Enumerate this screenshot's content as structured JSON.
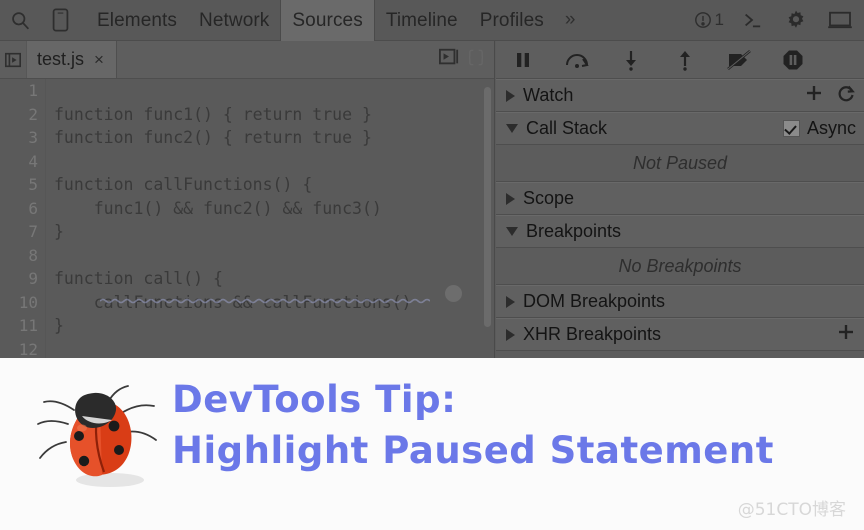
{
  "toolbar": {
    "icons": [
      {
        "name": "inspect-element-icon",
        "glyph": "search"
      },
      {
        "name": "device-toolbar-icon",
        "glyph": "device"
      }
    ],
    "tabs": [
      {
        "label": "Elements",
        "active": false
      },
      {
        "label": "Network",
        "active": false
      },
      {
        "label": "Sources",
        "active": true
      },
      {
        "label": "Timeline",
        "active": false
      },
      {
        "label": "Profiles",
        "active": false
      }
    ],
    "more_label": "»",
    "error_count": "1",
    "right_icons": [
      {
        "name": "warning-count-icon",
        "label": "1"
      },
      {
        "name": "console-drawer-icon",
        "label": ">_"
      },
      {
        "name": "settings-gear-icon",
        "label": "gear"
      },
      {
        "name": "dock-side-icon",
        "label": "dock"
      }
    ]
  },
  "editor": {
    "navigator_button": "show-navigator",
    "file_tab": {
      "name": "test.js",
      "close": "×"
    },
    "right_buttons": [
      "pretty-print",
      "format"
    ],
    "lines": [
      {
        "num": "1",
        "text": ""
      },
      {
        "num": "2",
        "text": "function func1() { return true }"
      },
      {
        "num": "3",
        "text": "function func2() { return true }"
      },
      {
        "num": "4",
        "text": ""
      },
      {
        "num": "5",
        "text": "function callFunctions() {"
      },
      {
        "num": "6",
        "text": "    func1() && func2() && func3()"
      },
      {
        "num": "7",
        "text": "}"
      },
      {
        "num": "8",
        "text": ""
      },
      {
        "num": "9",
        "text": "function call() {"
      },
      {
        "num": "10",
        "text": "    callFunctions && callFunctions()"
      },
      {
        "num": "11",
        "text": "}"
      },
      {
        "num": "12",
        "text": ""
      }
    ]
  },
  "debugger": {
    "controls": [
      {
        "name": "resume-pause-button",
        "title": "Pause script execution"
      },
      {
        "name": "step-over-button",
        "title": "Step over next function call"
      },
      {
        "name": "step-into-button",
        "title": "Step into next function call"
      },
      {
        "name": "step-out-button",
        "title": "Step out of current function"
      },
      {
        "name": "deactivate-breakpoints-button",
        "title": "Deactivate breakpoints"
      },
      {
        "name": "pause-on-exceptions-button",
        "title": "Pause on exceptions"
      }
    ],
    "sections": [
      {
        "label": "Watch",
        "expanded": false
      },
      {
        "label": "Call Stack",
        "expanded": true
      },
      {
        "label": "Scope",
        "expanded": false
      },
      {
        "label": "Breakpoints",
        "expanded": true
      },
      {
        "label": "DOM Breakpoints",
        "expanded": false
      },
      {
        "label": "XHR Breakpoints",
        "expanded": false
      }
    ],
    "watch_add": "+",
    "watch_refresh": "↻",
    "async_label": "Async",
    "async_checked": true,
    "call_stack_empty": "Not Paused",
    "breakpoints_empty": "No Breakpoints",
    "xhr_add": "+"
  },
  "caption": {
    "line1": "DevTools Tip:",
    "line2": "Highlight Paused Statement",
    "accent_color": "#6b78e8",
    "bug_icon": "ladybug-illustration"
  },
  "watermark": "@51CTO博客"
}
